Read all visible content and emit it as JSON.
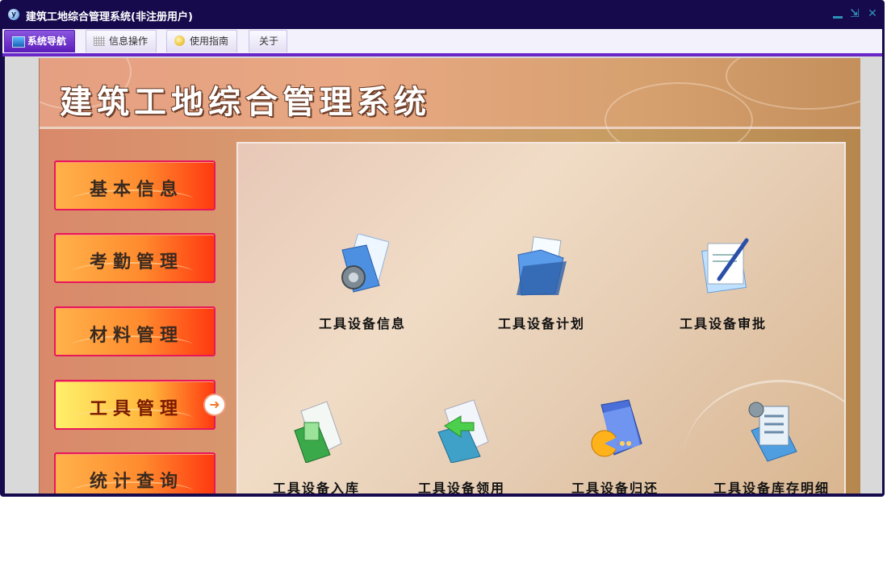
{
  "window": {
    "title": "建筑工地综合管理系统(非注册用户)",
    "controls": {
      "minimize": "–",
      "restore": "⇲",
      "close": "✕"
    }
  },
  "tabs": [
    {
      "label": "系统导航",
      "active": true,
      "icon": "monitor-icon"
    },
    {
      "label": "信息操作",
      "active": false,
      "icon": "grid-icon"
    },
    {
      "label": "使用指南",
      "active": false,
      "icon": "coin-icon"
    },
    {
      "label": "关于",
      "active": false,
      "icon": ""
    }
  ],
  "banner": {
    "title": "建筑工地综合管理系统"
  },
  "menu": [
    {
      "label": "基本信息",
      "active": false
    },
    {
      "label": "考勤管理",
      "active": false
    },
    {
      "label": "材料管理",
      "active": false
    },
    {
      "label": "工具管理",
      "active": true
    },
    {
      "label": "统计查询",
      "active": false
    }
  ],
  "tiles": [
    {
      "label": "工具设备信息",
      "icon": "folder-gear-icon"
    },
    {
      "label": "工具设备计划",
      "icon": "open-folder-icon"
    },
    {
      "label": "工具设备审批",
      "icon": "document-pen-icon"
    },
    {
      "label": "工具设备入库",
      "icon": "folder-add-icon"
    },
    {
      "label": "工具设备领用",
      "icon": "folder-transfer-icon"
    },
    {
      "label": "工具设备归还",
      "icon": "folder-return-icon"
    },
    {
      "label": "工具设备库存明细",
      "icon": "folder-list-icon"
    }
  ],
  "colors": {
    "title_bar": "#160a4d",
    "tab_active": "#6a27c8",
    "menu_border": "#e8175a"
  }
}
